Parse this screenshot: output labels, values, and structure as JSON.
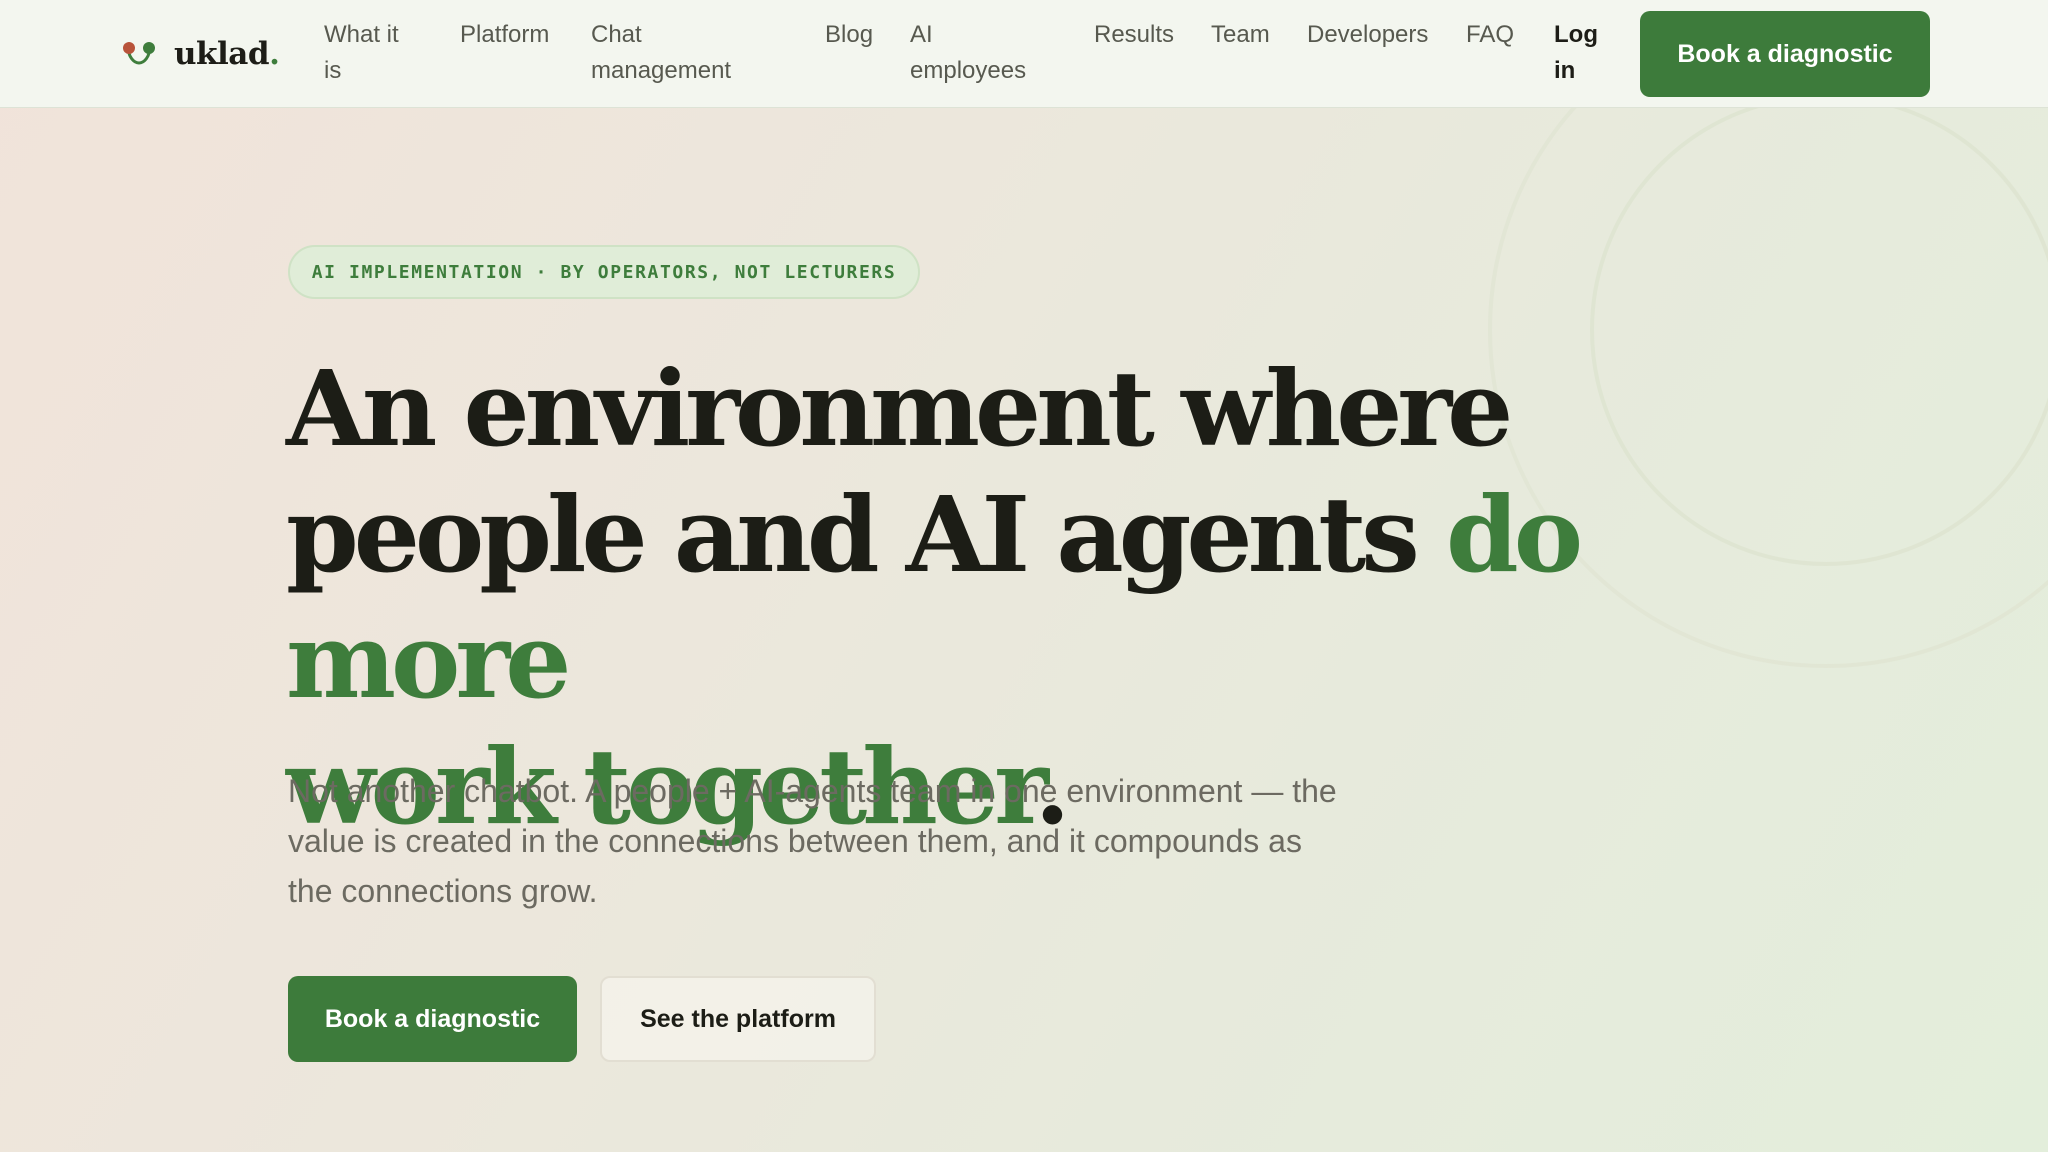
{
  "brand": {
    "name": "uklad",
    "dot": ".",
    "icon": "uklad-logo-icon",
    "colors": {
      "accent": "#3e7d3c",
      "logo_left": "#b8533a",
      "logo_right": "#3e7d3c",
      "text_dark": "#1c1d16"
    }
  },
  "nav": {
    "items": [
      {
        "id": "what-it-is",
        "line1": "What it",
        "line2": "is"
      },
      {
        "id": "platform",
        "line1": "Platform",
        "line2": ""
      },
      {
        "id": "chat-management",
        "line1": "Chat",
        "line2": "management"
      },
      {
        "id": "blog",
        "line1": "Blog",
        "line2": ""
      },
      {
        "id": "ai-employees",
        "line1": "AI",
        "line2": "employees"
      },
      {
        "id": "results",
        "line1": "Results",
        "line2": ""
      },
      {
        "id": "team",
        "line1": "Team",
        "line2": ""
      },
      {
        "id": "developers",
        "line1": "Developers",
        "line2": ""
      },
      {
        "id": "faq",
        "line1": "FAQ",
        "line2": ""
      }
    ],
    "login": {
      "line1": "Log",
      "line2": "in"
    },
    "cta": "Book a diagnostic"
  },
  "hero": {
    "eyebrow": "AI IMPLEMENTATION · BY OPERATORS, NOT LECTURERS",
    "headline": {
      "line1": "An environment where",
      "line2": "people and AI agents ",
      "line2_accent": "do more",
      "line3_accent": "work together",
      "line3_end": "."
    },
    "subtext": "Not another chatbot. A people + AI-agents team in one environment — the value is created in the connections between them, and it compounds as the connections grow.",
    "primary_cta": "Book a diagnostic",
    "secondary_cta": "See the platform"
  }
}
